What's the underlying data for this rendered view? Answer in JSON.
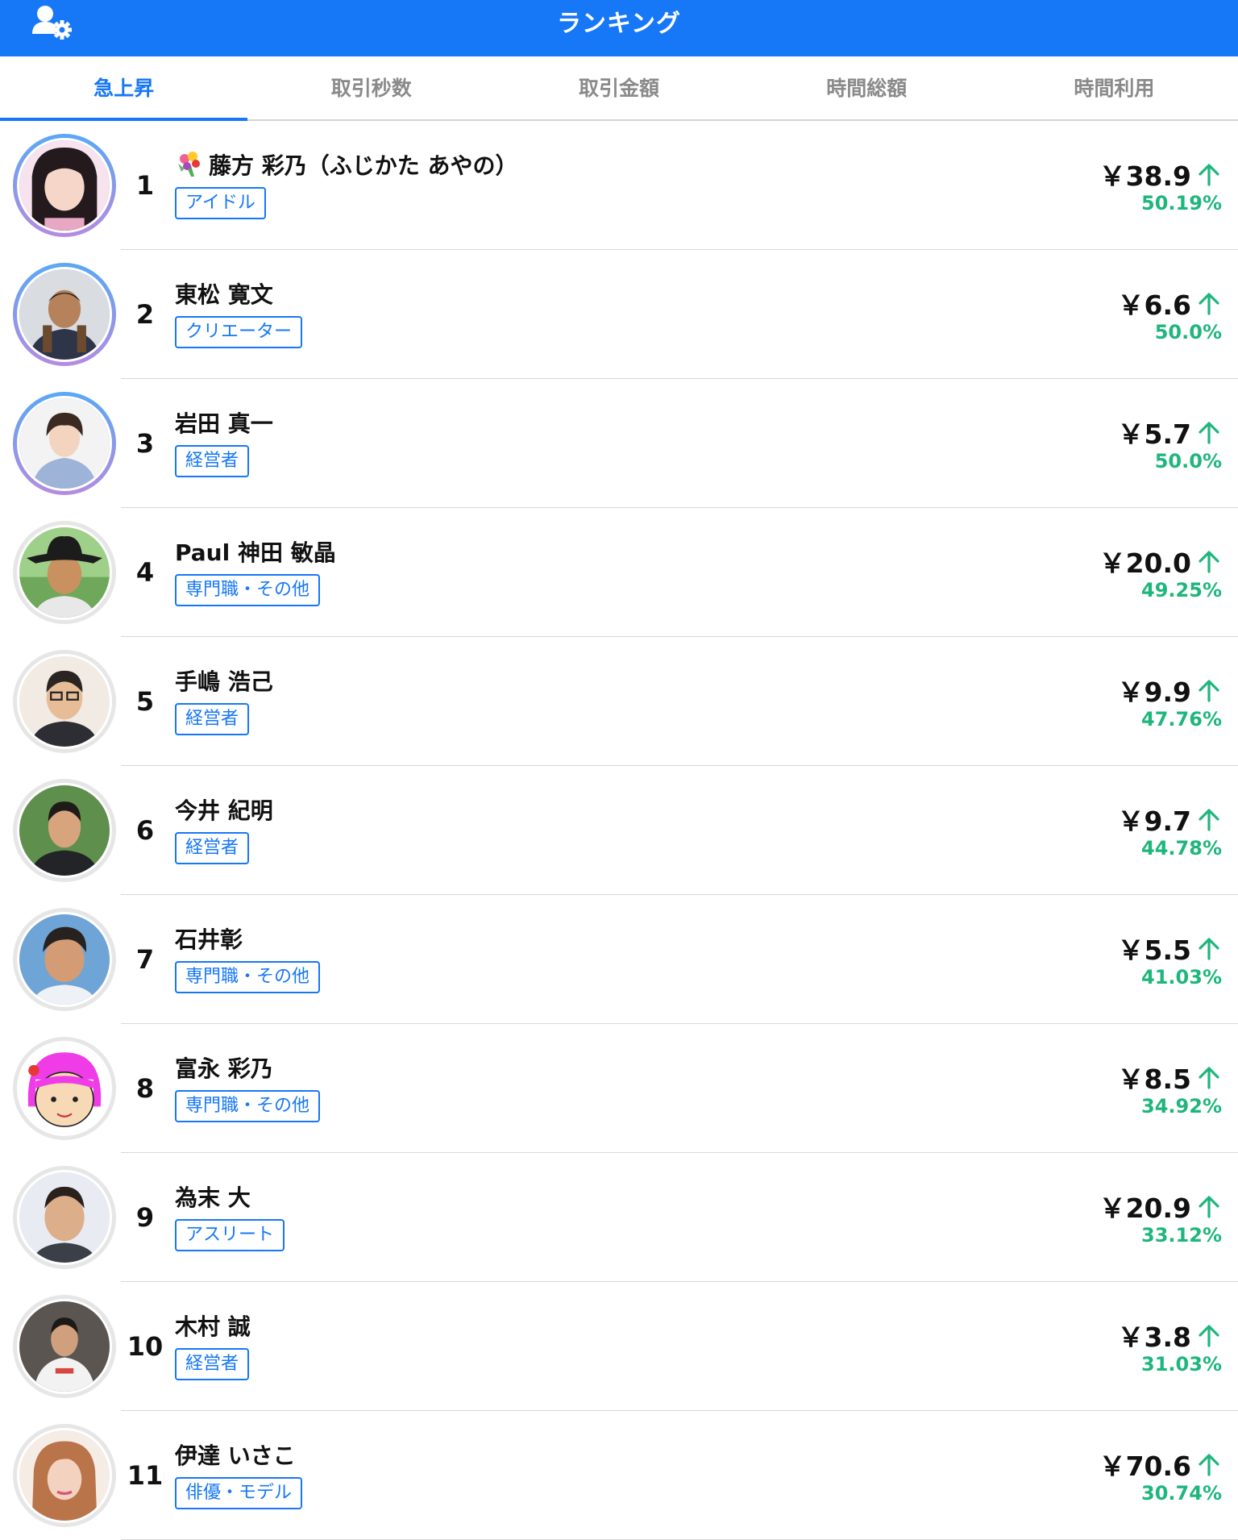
{
  "header": {
    "title": "ランキング"
  },
  "tabs": [
    {
      "label": "急上昇",
      "active": true
    },
    {
      "label": "取引秒数",
      "active": false
    },
    {
      "label": "取引金額",
      "active": false
    },
    {
      "label": "時間総額",
      "active": false
    },
    {
      "label": "時間利用",
      "active": false
    }
  ],
  "colors": {
    "accent": "#1677f7",
    "up": "#1fb67d"
  },
  "ranking": [
    {
      "rank": "1",
      "name": "藤方 彩乃（ふじかた あやの）",
      "tag": "アイドル",
      "price": "￥38.9",
      "change": "50.19%",
      "trend_icon": "arrow-up-icon",
      "name_icon": "bouquet-icon"
    },
    {
      "rank": "2",
      "name": "東松 寛文",
      "tag": "クリエーター",
      "price": "￥6.6",
      "change": "50.0%",
      "trend_icon": "arrow-up-icon"
    },
    {
      "rank": "3",
      "name": "岩田 真一",
      "tag": "経営者",
      "price": "￥5.7",
      "change": "50.0%",
      "trend_icon": "arrow-up-icon"
    },
    {
      "rank": "4",
      "name": "Paul 神田 敏晶",
      "tag": "専門職・その他",
      "price": "￥20.0",
      "change": "49.25%",
      "trend_icon": "arrow-up-icon"
    },
    {
      "rank": "5",
      "name": "手嶋 浩己",
      "tag": "経営者",
      "price": "￥9.9",
      "change": "47.76%",
      "trend_icon": "arrow-up-icon"
    },
    {
      "rank": "6",
      "name": "今井 紀明",
      "tag": "経営者",
      "price": "￥9.7",
      "change": "44.78%",
      "trend_icon": "arrow-up-icon"
    },
    {
      "rank": "7",
      "name": "石井彰",
      "tag": "専門職・その他",
      "price": "￥5.5",
      "change": "41.03%",
      "trend_icon": "arrow-up-icon"
    },
    {
      "rank": "8",
      "name": "富永 彩乃",
      "tag": "専門職・その他",
      "price": "￥8.5",
      "change": "34.92%",
      "trend_icon": "arrow-up-icon"
    },
    {
      "rank": "9",
      "name": "為末 大",
      "tag": "アスリート",
      "price": "￥20.9",
      "change": "33.12%",
      "trend_icon": "arrow-up-icon"
    },
    {
      "rank": "10",
      "name": "木村 誠",
      "tag": "経営者",
      "price": "￥3.8",
      "change": "31.03%",
      "trend_icon": "arrow-up-icon"
    },
    {
      "rank": "11",
      "name": "伊達 いさこ",
      "tag": "俳優・モデル",
      "price": "￥70.6",
      "change": "30.74%",
      "trend_icon": "arrow-up-icon"
    }
  ]
}
